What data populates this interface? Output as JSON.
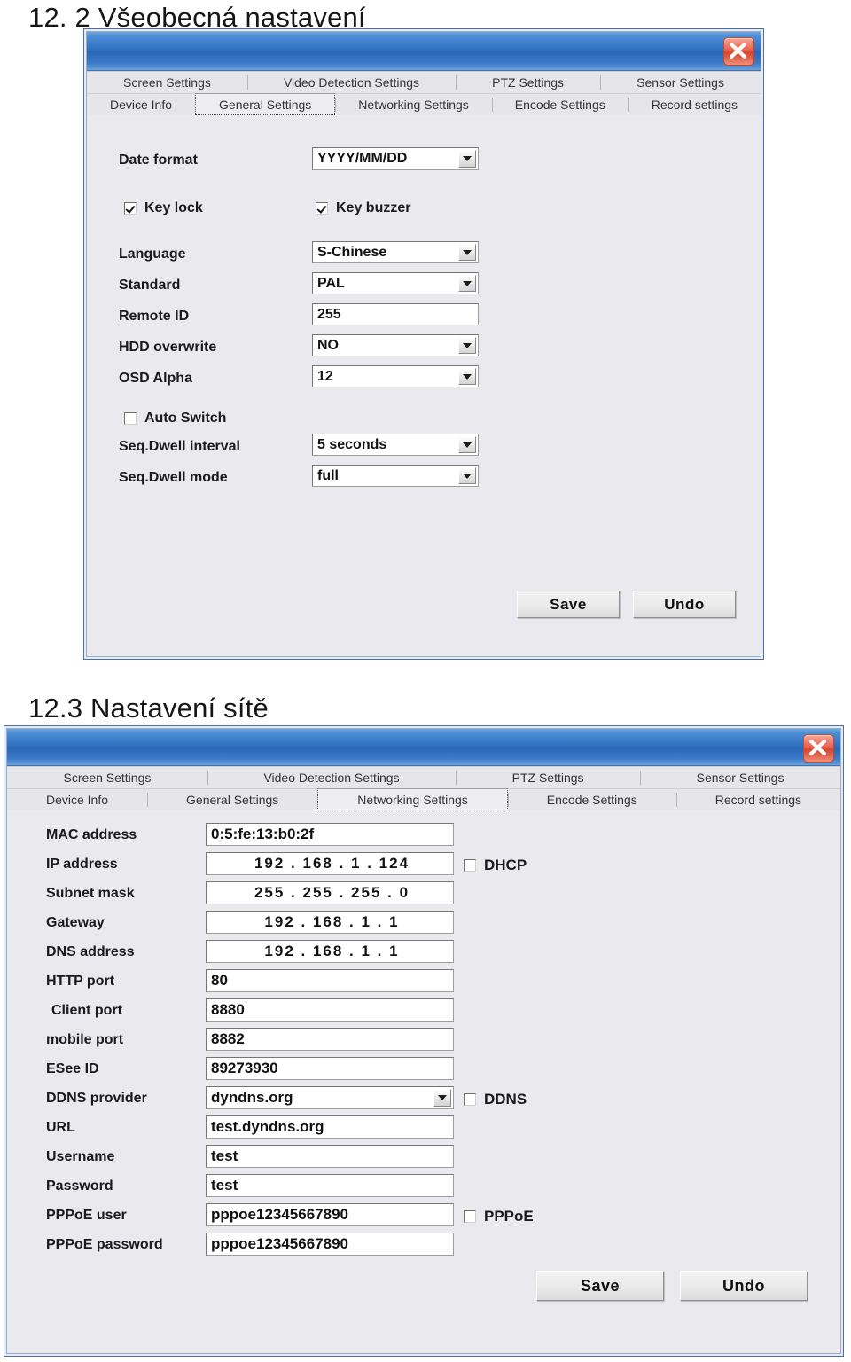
{
  "headings": {
    "section_general": "12. 2 Všeobecná nastavení",
    "section_network": "12.3 Nastavení sítě"
  },
  "common": {
    "close_icon": "close-icon",
    "tabs_row_top": [
      "Screen Settings",
      "Video Detection Settings",
      "PTZ Settings",
      "Sensor Settings"
    ],
    "tabs_row_bottom": [
      "Device Info",
      "General Settings",
      "Networking Settings",
      "Encode Settings",
      "Record settings"
    ],
    "save_label": "Save",
    "undo_label": "Undo",
    "colors": {
      "titlebar": "#2f6fc0",
      "close_button": "#d6442c",
      "dialog_background": "#e9e9ee",
      "border": "#4a6fa8"
    }
  },
  "general_window": {
    "selected_tab": "General Settings",
    "fields": [
      {
        "label": "Date format",
        "value": "YYYY/MM/DD",
        "type": "combo"
      },
      {
        "label": "Language",
        "value": "S-Chinese",
        "type": "combo"
      },
      {
        "label": "Standard",
        "value": "PAL",
        "type": "combo"
      },
      {
        "label": "Remote ID",
        "value": "255",
        "type": "text"
      },
      {
        "label": "HDD overwrite",
        "value": "NO",
        "type": "combo"
      },
      {
        "label": "OSD Alpha",
        "value": "12",
        "type": "combo"
      },
      {
        "label": "Seq.Dwell interval",
        "value": "5 seconds",
        "type": "combo"
      },
      {
        "label": "Seq.Dwell mode",
        "value": "full",
        "type": "combo"
      }
    ],
    "checkboxes": [
      {
        "label": "Key lock",
        "checked": true
      },
      {
        "label": "Key buzzer",
        "checked": true
      },
      {
        "label": "Auto Switch",
        "checked": false
      }
    ]
  },
  "network_window": {
    "selected_tab": "Networking Settings",
    "fields": [
      {
        "label": "MAC address",
        "value": "0:5:fe:13:b0:2f",
        "type": "text"
      },
      {
        "label": "IP address",
        "value": "192 . 168 .  1  . 124",
        "type": "ip"
      },
      {
        "label": "Subnet mask",
        "value": "255 . 255 . 255 .  0",
        "type": "ip"
      },
      {
        "label": "Gateway",
        "value": "192 . 168 .  1  .  1",
        "type": "ip"
      },
      {
        "label": "DNS address",
        "value": "192 . 168 .  1  .  1",
        "type": "ip"
      },
      {
        "label": "HTTP port",
        "value": "80",
        "type": "text"
      },
      {
        "label": "Client port",
        "value": "8880",
        "type": "text"
      },
      {
        "label": "mobile port",
        "value": "8882",
        "type": "text"
      },
      {
        "label": "ESee ID",
        "value": "89273930",
        "type": "text"
      },
      {
        "label": "DDNS provider",
        "value": "dyndns.org",
        "type": "combo"
      },
      {
        "label": "URL",
        "value": "test.dyndns.org",
        "type": "text"
      },
      {
        "label": "Username",
        "value": "test",
        "type": "text"
      },
      {
        "label": "Password",
        "value": "test",
        "type": "text"
      },
      {
        "label": "PPPoE user",
        "value": "pppoe12345667890",
        "type": "text"
      },
      {
        "label": "PPPoE password",
        "value": "pppoe12345667890",
        "type": "text"
      }
    ],
    "checkboxes": [
      {
        "label": "DHCP",
        "checked": false
      },
      {
        "label": "DDNS",
        "checked": false
      },
      {
        "label": "PPPoE",
        "checked": false
      }
    ]
  }
}
